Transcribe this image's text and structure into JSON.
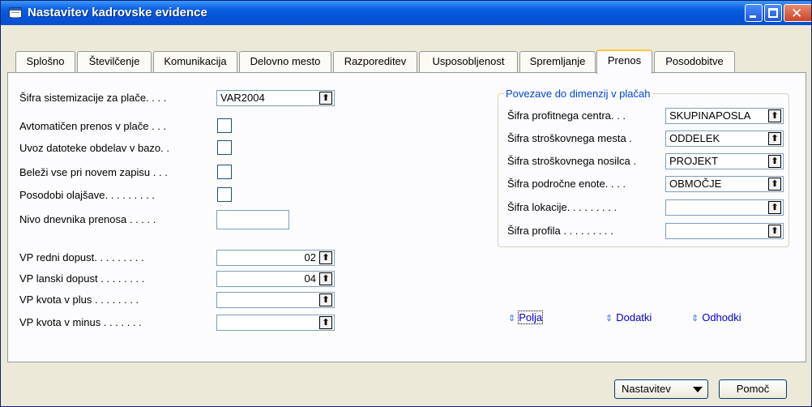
{
  "window": {
    "title": "Nastavitev kadrovske evidence"
  },
  "tabs": [
    {
      "label": "Splošno"
    },
    {
      "label": "Številčenje"
    },
    {
      "label": "Komunikacija"
    },
    {
      "label": "Delovno mesto"
    },
    {
      "label": "Razporeditev"
    },
    {
      "label": "Usposobljenost"
    },
    {
      "label": "Spremljanje"
    },
    {
      "label": "Prenos"
    },
    {
      "label": "Posodobitve"
    }
  ],
  "active_tab": "Prenos",
  "left": {
    "sistemizacija_label": "Šifra sistemizacije za plače. . . .",
    "sistemizacija_value": "VAR2004",
    "avtomaticen_label": "Avtomatičen prenos v plače . . .",
    "uvoz_label": "Uvoz datoteke obdelav v bazo. .",
    "belezi_label": "Beleži vse pri novem zapisu . . .",
    "posodobi_label": "Posodobi olajšave. . . . . . . . .",
    "nivo_label": "Nivo dnevnika prenosa . . . . .",
    "nivo_value": "",
    "redni_label": "VP redni dopust. . . . . . . . .",
    "redni_value": "02",
    "lanski_label": "VP lanski dopust . . . . . . . .",
    "lanski_value": "04",
    "plus_label": "VP kvota v plus . . . . . . . .",
    "plus_value": "",
    "minus_label": "VP kvota v minus . . . . . . .",
    "minus_value": ""
  },
  "group": {
    "title": "Povezave do dimenzij v plačah",
    "rows": [
      {
        "label": "Šifra profitnega centra. . .",
        "value": "SKUPINAPOSLA"
      },
      {
        "label": "Šifra stroškovnega mesta  .",
        "value": "ODDELEK"
      },
      {
        "label": "Šifra stroškovnega nosilca  .",
        "value": "PROJEKT"
      },
      {
        "label": "Šifra področne enote. . . .",
        "value": "OBMOČJE"
      },
      {
        "label": "Šifra lokacije. . . . . . . . .",
        "value": ""
      },
      {
        "label": "Šifra profila . . . . . . . . .",
        "value": ""
      }
    ]
  },
  "links": {
    "polja": "Polja",
    "dodatki": "Dodatki",
    "odhodki": "Odhodki"
  },
  "buttons": {
    "nastavitev": "Nastavitev",
    "pomoc": "Pomoč"
  },
  "icons": {
    "assist_button": "arrow-up-icon",
    "link": "link-arrows-icon",
    "dropdown": "chevron-down-icon"
  }
}
